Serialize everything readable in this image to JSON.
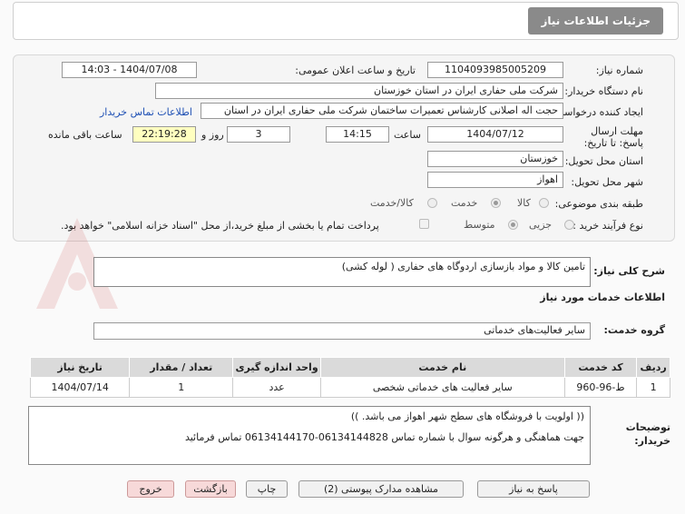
{
  "title": "جزئیات اطلاعات نیاز",
  "fields": {
    "need_number_label": "شماره نیاز:",
    "need_number": "1104093985005209",
    "announce_label": "تاریخ و ساعت اعلان عمومی:",
    "announce_value": "1404/07/08 - 14:03",
    "buyer_org_label": "نام دستگاه خریدار:",
    "buyer_org": "شرکت ملی حفاری ایران در استان خوزستان",
    "creator_label": "ایجاد کننده درخواست:",
    "creator": "حجت اله اصلانی کارشناس تعمیرات ساختمان شرکت ملی حفاری ایران در استان",
    "contact_link": "اطلاعات تماس خریدار",
    "deadline_label": "مهلت ارسال پاسخ: تا تاریخ:",
    "deadline_date": "1404/07/12",
    "time_label": "ساعت",
    "deadline_time": "14:15",
    "days_value": "3",
    "days_label": "روز و",
    "remaining_time": "22:19:28",
    "remaining_label": "ساعت باقی مانده",
    "province_label": "استان محل تحویل:",
    "province": "خوزستان",
    "city_label": "شهر محل تحویل:",
    "city": "اهواز",
    "category_label": "طبقه بندی موضوعی:",
    "category_options": [
      "کالا",
      "خدمت",
      "کالا/خدمت"
    ],
    "process_label": "نوع فرآیند خرید :",
    "process_options": [
      "جزیی",
      "متوسط"
    ],
    "payment_note": "پرداخت تمام یا بخشی از مبلغ خرید،از محل \"اسناد خزانه اسلامی\" خواهد بود."
  },
  "description": {
    "label": "شرح کلی نیاز:",
    "value": "تامین کالا و مواد بازسازی اردوگاه های حفاری ( لوله کشی)"
  },
  "services_heading": "اطلاعات خدمات مورد نیاز",
  "service_group": {
    "label": "گروه خدمت:",
    "value": "سایر فعالیت‌های خدماتی"
  },
  "table": {
    "headers": [
      "ردیف",
      "کد خدمت",
      "نام خدمت",
      "واحد اندازه گیری",
      "تعداد / مقدار",
      "تاریخ نیاز"
    ],
    "rows": [
      [
        "1",
        "ط-96-960",
        "سایر فعالیت های خدماتی شخصی",
        "عدد",
        "1",
        "1404/07/14"
      ]
    ]
  },
  "buyer_notes": {
    "label": "توضیحات خریدار:",
    "line1": "((  اولویت با فروشگاه های سطح شهر اهواز می باشد. ))",
    "line2": "جهت هماهنگی و هرگونه سوال با شماره تماس 06134144828-06134144170 تماس فرمائید"
  },
  "buttons": {
    "reply": "پاسخ به نیاز",
    "attachments": "مشاهده مدارک پیوستی (2)",
    "print": "چاپ",
    "back": "بازگشت",
    "exit": "خروج"
  }
}
